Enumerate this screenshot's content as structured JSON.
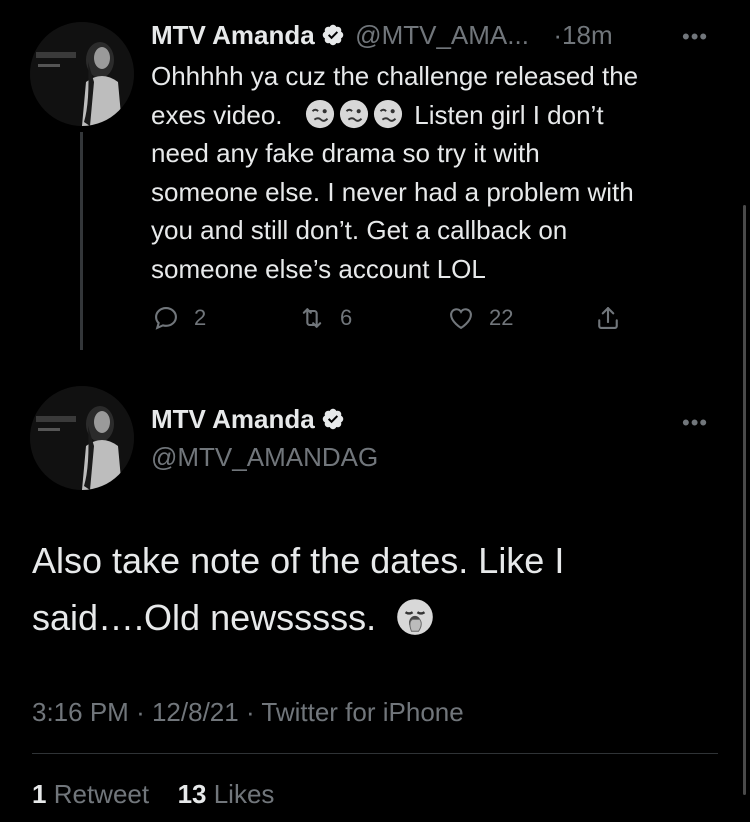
{
  "tweet1": {
    "name": "MTV Amanda",
    "handle": "@MTV_AMA...",
    "separator": "·",
    "time": "18m",
    "more": "•••",
    "lines": [
      "Ohhhhh ya cuz the challenge released the",
      "exes video.",
      "Listen girl I don’t",
      "need any fake drama so try it with",
      "someone else. I never had a problem with",
      "you and still don’t. Get a callback on",
      "someone else’s account LOL"
    ],
    "emojis": [
      "woozy-face-emoji",
      "woozy-face-emoji",
      "woozy-face-emoji"
    ],
    "actions": {
      "replies": "2",
      "retweets": "6",
      "likes": "22"
    }
  },
  "tweet2": {
    "name": "MTV Amanda",
    "handle": "@MTV_AMANDAG",
    "more": "•••",
    "text_line1": "Also take note of the dates. Like I",
    "text_line2": "said….Old newsssss.",
    "emoji": "yawning-face-emoji",
    "time": "3:16 PM",
    "date": "12/8/21",
    "source": "Twitter for iPhone",
    "dot": "·",
    "retweet_count": "1",
    "retweet_label": "Retweet",
    "like_count": "13",
    "like_label": "Likes"
  },
  "colors": {
    "background": "#000000",
    "text": "#e7e9ea",
    "secondary": "#71767b",
    "verified": "#e7e9ea"
  }
}
